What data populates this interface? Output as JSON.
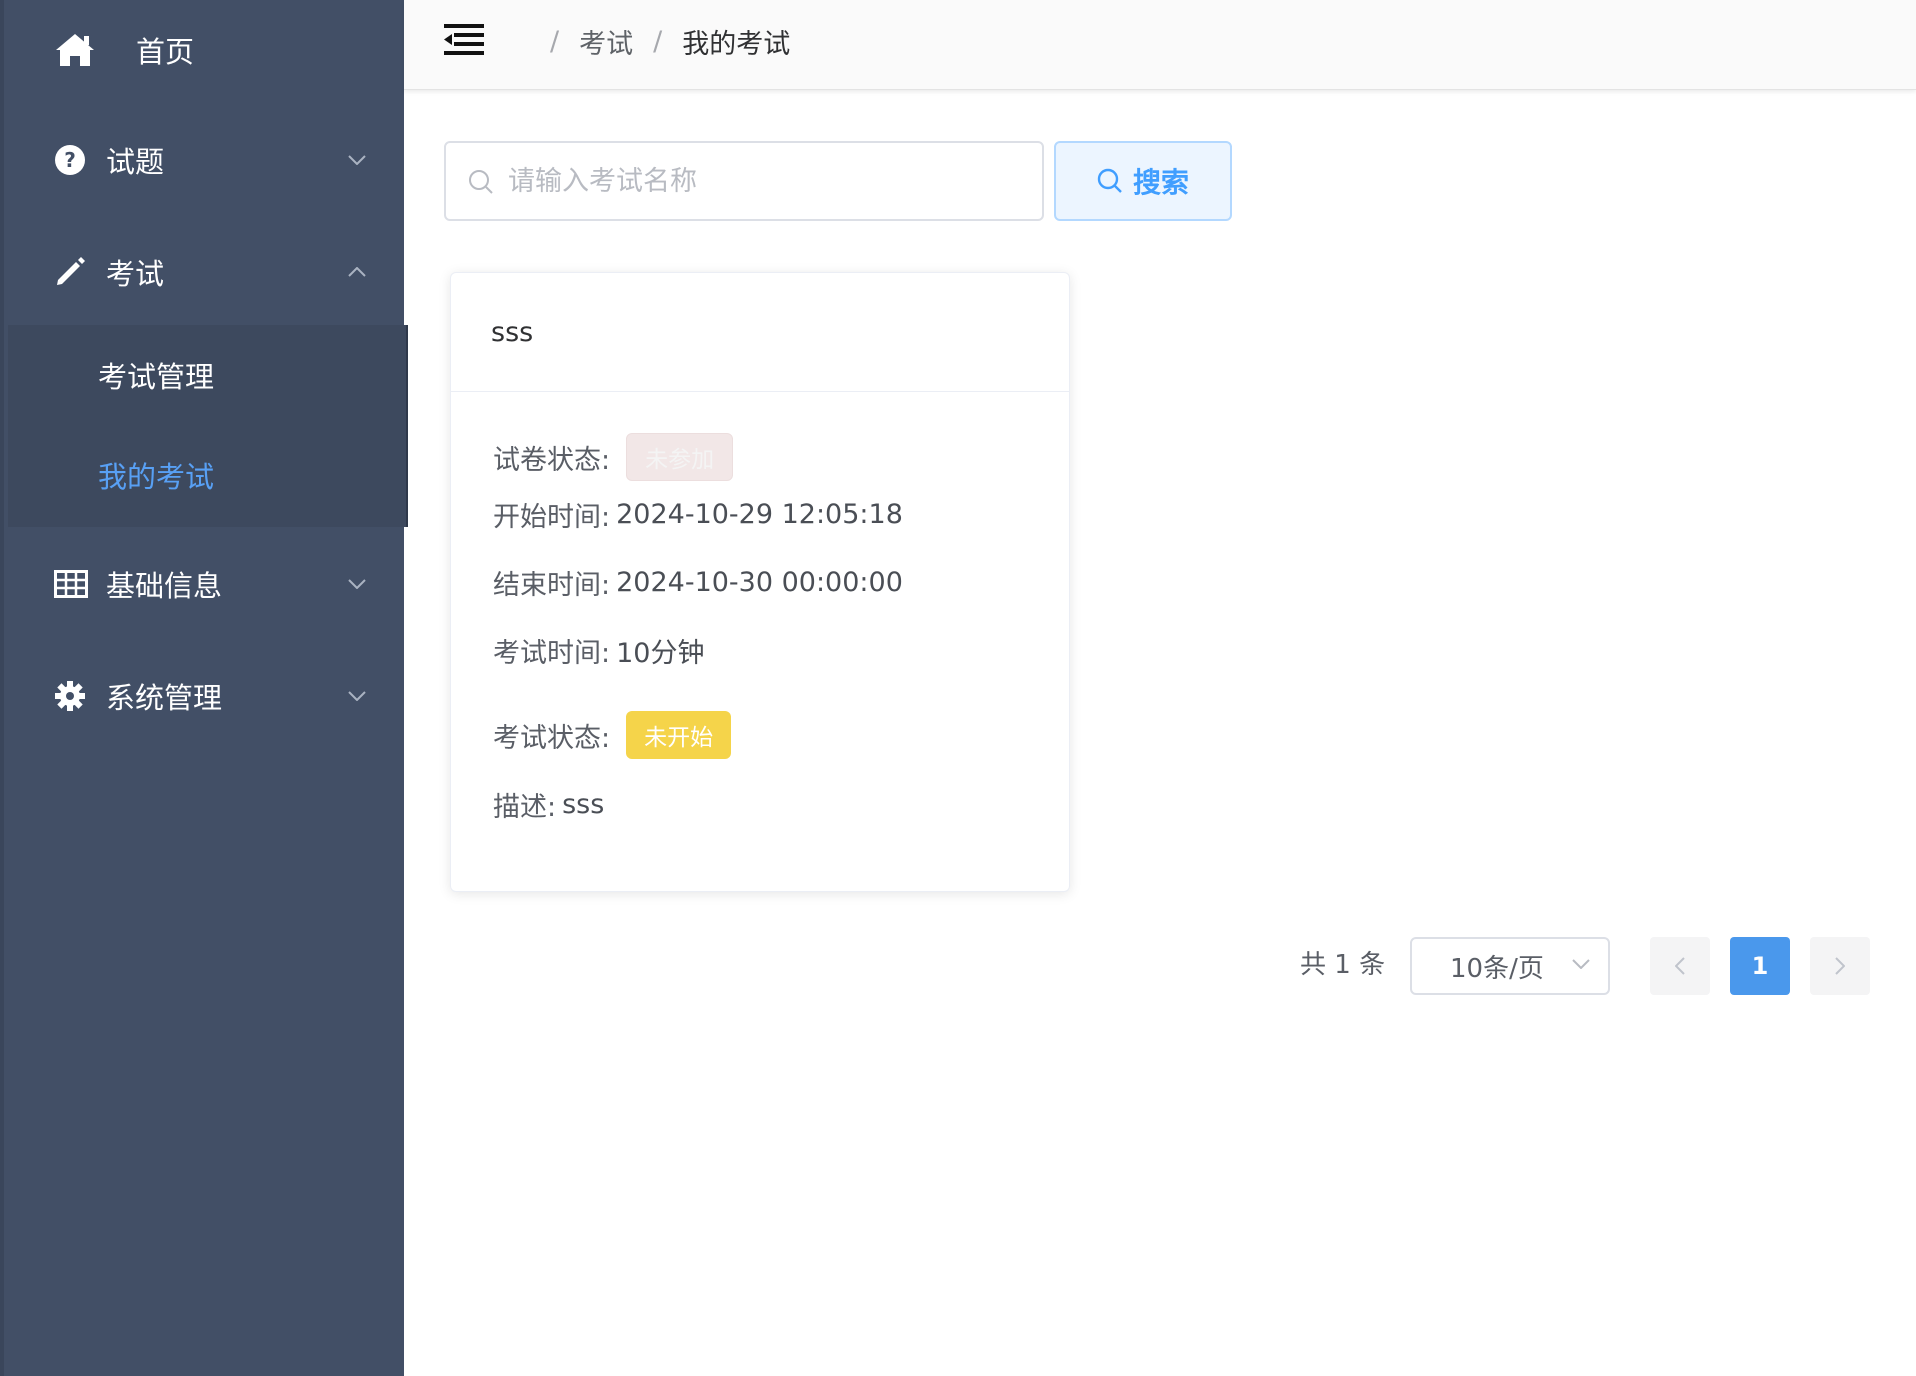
{
  "sidebar": {
    "home": {
      "label": "首页",
      "icon": "home-icon"
    },
    "questions": {
      "label": "试题",
      "icon": "question-circle-icon"
    },
    "exams": {
      "label": "考试",
      "icon": "pencil-icon",
      "children": [
        {
          "label": "考试管理",
          "active": false
        },
        {
          "label": "我的考试",
          "active": true
        }
      ]
    },
    "basic_info": {
      "label": "基础信息",
      "icon": "table-icon"
    },
    "system": {
      "label": "系统管理",
      "icon": "gear-icon"
    }
  },
  "header": {
    "breadcrumbs": [
      "考试",
      "我的考试"
    ],
    "separator": "/"
  },
  "search": {
    "placeholder": "请输入考试名称",
    "button_label": "搜索"
  },
  "card": {
    "title": "sss",
    "paper_status_label": "试卷状态:",
    "paper_status": "未参加",
    "start_label": "开始时间:",
    "start_time": "2024-10-29 12:05:18",
    "end_label": "结束时间:",
    "end_time": "2024-10-30 00:00:00",
    "duration_label": "考试时间:",
    "duration": "10分钟",
    "exam_status_label": "考试状态:",
    "exam_status": "未开始",
    "desc_label": "描述:",
    "desc": "sss"
  },
  "pagination": {
    "total_text": "共 1 条",
    "page_size": "10条/页",
    "current_page": "1"
  },
  "colors": {
    "sidebar_bg": "#424f66",
    "active_menu": "#58a0f5",
    "primary": "#409eff",
    "tag_yellow": "#f5d44a",
    "tag_pink": "#f2e7e7"
  }
}
